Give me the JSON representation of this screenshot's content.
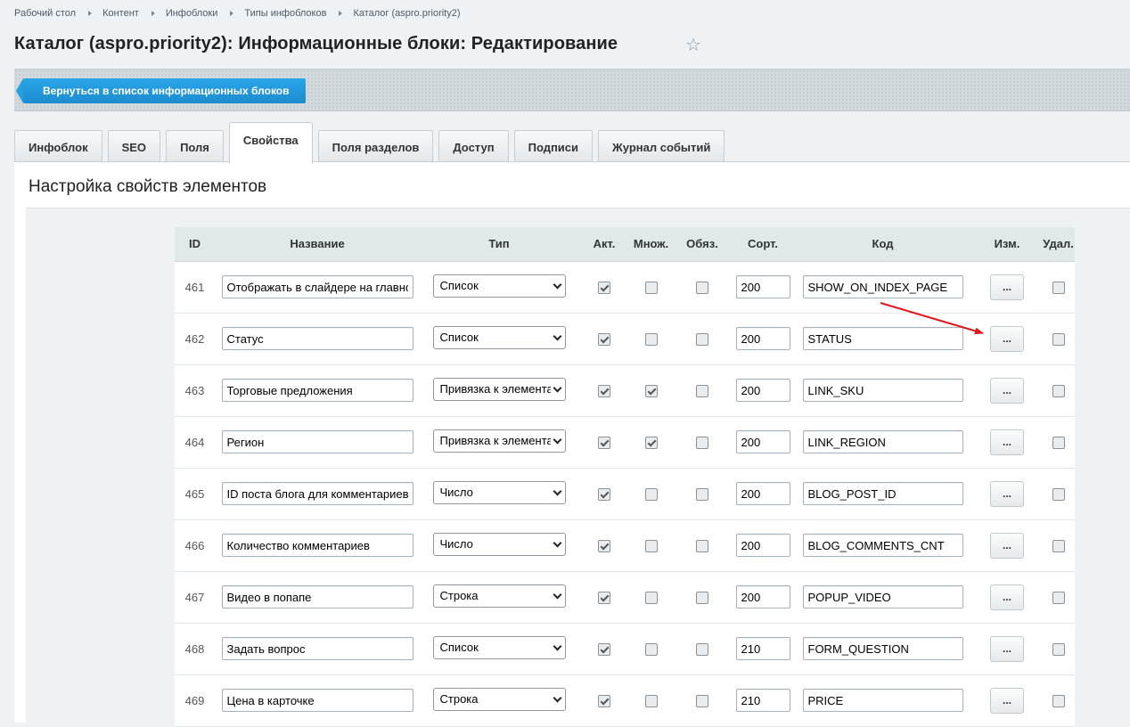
{
  "breadcrumbs": [
    "Рабочий стол",
    "Контент",
    "Инфоблоки",
    "Типы инфоблоков",
    "Каталог (aspro.priority2)"
  ],
  "page_title": "Каталог (aspro.priority2): Информационные блоки: Редактирование",
  "toolbar": {
    "back_label": "Вернуться в список информационных блоков"
  },
  "tabs": [
    {
      "label": "Инфоблок",
      "active": false
    },
    {
      "label": "SEO",
      "active": false
    },
    {
      "label": "Поля",
      "active": false
    },
    {
      "label": "Свойства",
      "active": true
    },
    {
      "label": "Поля разделов",
      "active": false
    },
    {
      "label": "Доступ",
      "active": false
    },
    {
      "label": "Подписи",
      "active": false
    },
    {
      "label": "Журнал событий",
      "active": false
    }
  ],
  "section_title": "Настройка свойств элементов",
  "table": {
    "headers": {
      "id": "ID",
      "name": "Название",
      "type": "Тип",
      "active": "Акт.",
      "multiple": "Множ.",
      "required": "Обяз.",
      "sort": "Сорт.",
      "code": "Код",
      "edit": "Изм.",
      "delete": "Удал."
    },
    "edit_label": "...",
    "rows": [
      {
        "id": "461",
        "name": "Отображать в слайдере на главной",
        "type": "Список",
        "active": true,
        "multiple": false,
        "required": false,
        "sort": "200",
        "code": "SHOW_ON_INDEX_PAGE"
      },
      {
        "id": "462",
        "name": "Статус",
        "type": "Список",
        "active": true,
        "multiple": false,
        "required": false,
        "sort": "200",
        "code": "STATUS"
      },
      {
        "id": "463",
        "name": "Торговые предложения",
        "type": "Привязка к элементам",
        "active": true,
        "multiple": true,
        "required": false,
        "sort": "200",
        "code": "LINK_SKU"
      },
      {
        "id": "464",
        "name": "Регион",
        "type": "Привязка к элементам",
        "active": true,
        "multiple": true,
        "required": false,
        "sort": "200",
        "code": "LINK_REGION"
      },
      {
        "id": "465",
        "name": "ID поста блога для комментариев",
        "type": "Число",
        "active": true,
        "multiple": false,
        "required": false,
        "sort": "200",
        "code": "BLOG_POST_ID"
      },
      {
        "id": "466",
        "name": "Количество комментариев",
        "type": "Число",
        "active": true,
        "multiple": false,
        "required": false,
        "sort": "200",
        "code": "BLOG_COMMENTS_CNT"
      },
      {
        "id": "467",
        "name": "Видео в попапе",
        "type": "Строка",
        "active": true,
        "multiple": false,
        "required": false,
        "sort": "200",
        "code": "POPUP_VIDEO"
      },
      {
        "id": "468",
        "name": "Задать вопрос",
        "type": "Список",
        "active": true,
        "multiple": false,
        "required": false,
        "sort": "210",
        "code": "FORM_QUESTION"
      },
      {
        "id": "469",
        "name": "Цена в карточке",
        "type": "Строка",
        "active": true,
        "multiple": false,
        "required": false,
        "sort": "210",
        "code": "PRICE"
      }
    ]
  },
  "colors": {
    "accent_button": "#1c8ccf",
    "annotation_arrow": "#e0191d"
  }
}
